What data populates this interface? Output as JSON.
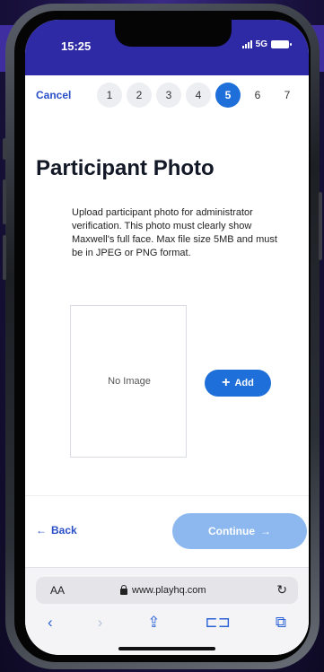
{
  "status": {
    "time": "15:25",
    "network": "5G"
  },
  "form": {
    "cancel_label": "Cancel",
    "steps": [
      "1",
      "2",
      "3",
      "4",
      "5",
      "6",
      "7"
    ],
    "current_step": 5,
    "title": "Participant Photo",
    "description": "Upload participant photo for administrator verification. This photo must clearly show Maxwell's full face. Max file size 5MB and must be in JPEG or PNG format.",
    "photo_placeholder": "No Image",
    "add_label": "Add",
    "back_label": "Back",
    "continue_label": "Continue"
  },
  "browser": {
    "aa_label": "AA",
    "url": "www.playhq.com"
  },
  "colors": {
    "accent": "#1e6fd9",
    "link": "#2a50c8",
    "continue_disabled": "#8db8ef",
    "status_bar": "#2e2aa6"
  },
  "icons": [
    "signal-icon",
    "battery-icon",
    "plus-icon",
    "arrow-left-icon",
    "arrow-right-icon",
    "lock-icon",
    "reload-icon",
    "back-icon",
    "forward-icon",
    "share-icon",
    "bookmarks-icon",
    "tabs-icon"
  ]
}
